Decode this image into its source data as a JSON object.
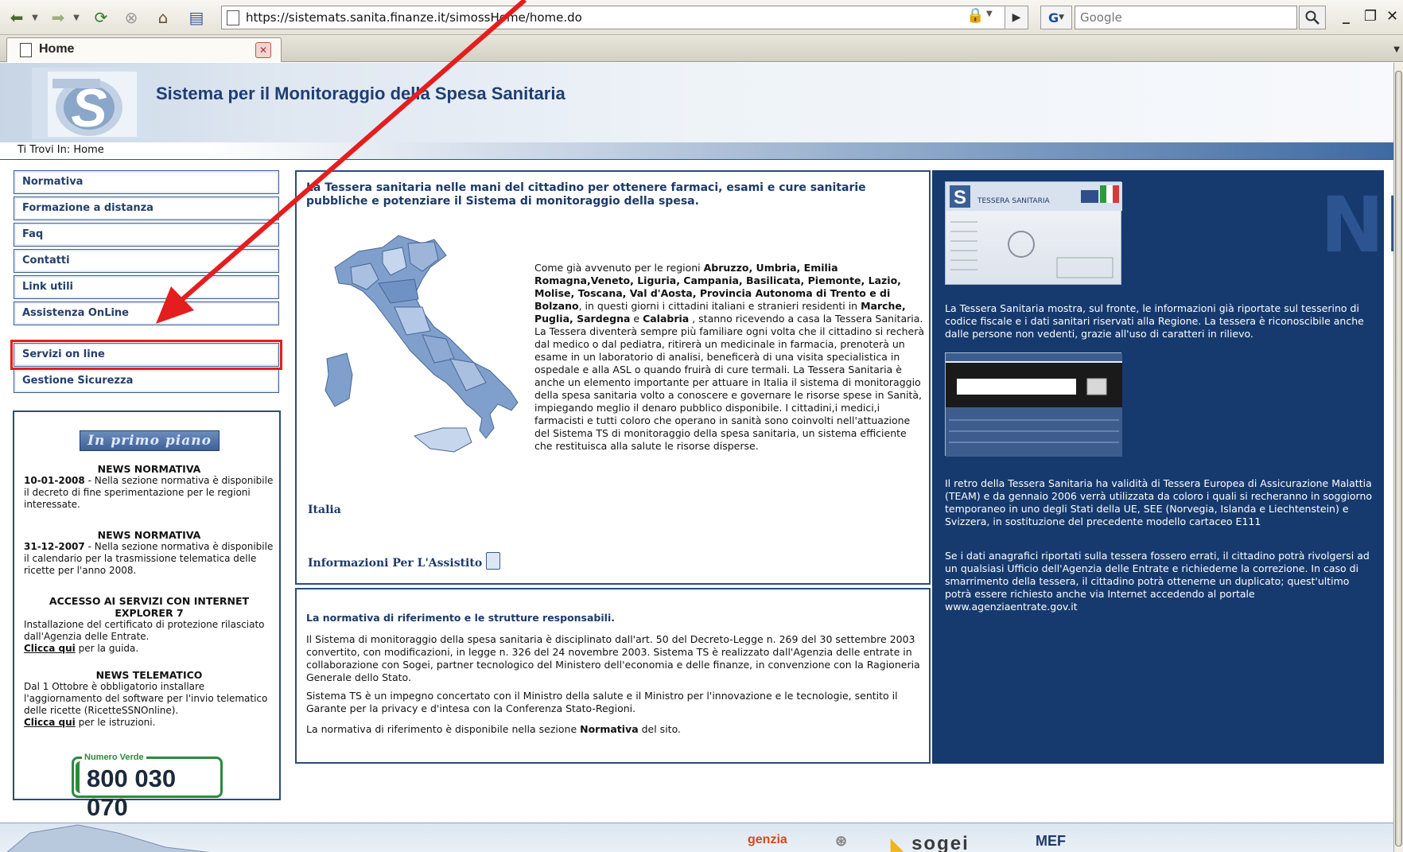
{
  "browser": {
    "url": "https://sistemats.sanita.finanze.it/simossHome/home.do",
    "search_placeholder": "Google",
    "search_engine_glyph": "G",
    "tab_label": "Home"
  },
  "site": {
    "title": "Sistema per il Monitoraggio della Spesa Sanitaria",
    "breadcrumb": "Ti Trovi In: Home"
  },
  "menu": {
    "items": [
      {
        "label": "Normativa"
      },
      {
        "label": "Formazione a distanza"
      },
      {
        "label": "Faq"
      },
      {
        "label": "Contatti"
      },
      {
        "label": "Link utili"
      },
      {
        "label": "Assistenza OnLine"
      },
      {
        "label": "Servizi on line"
      },
      {
        "label": "Gestione Sicurezza"
      }
    ]
  },
  "primo_piano": {
    "banner": "In primo piano",
    "news": [
      {
        "heading": "NEWS NORMATIVA",
        "date": "10-01-2008",
        "text": " - Nella sezione normativa è disponibile il decreto di fine sperimentazione per le regioni interessate."
      },
      {
        "heading": "NEWS NORMATIVA",
        "date": "31-12-2007",
        "text": " - Nella sezione normativa è disponibile il calendario per la trasmissione telematica delle ricette per l'anno 2008."
      },
      {
        "heading": "ACCESSO AI SERVIZI CON INTERNET EXPLORER 7",
        "text": "Installazione del certificato di protezione rilasciato dall'Agenzia delle Entrate.",
        "link": "Clicca qui",
        "link_tail": " per la guida."
      },
      {
        "heading": "NEWS TELEMATICO",
        "text": "Dal 1 Ottobre è obbligatorio installare l'aggiornamento del software per l'invio telematico delle ricette (RicetteSSNOnline).",
        "link": "Clicca qui",
        "link_tail": " per le istruzioni."
      }
    ],
    "numero_verde_label": "Numero Verde",
    "numero_verde": "800 030 070"
  },
  "center": {
    "title": "La Tessera sanitaria nelle mani del cittadino per ottenere farmaci, esami e cure sanitarie pubbliche e potenziare il Sistema di monitoraggio della spesa.",
    "body_intro": "Come già avvenuto per le regioni ",
    "body_regions1": "Abruzzo, Umbria, Emilia Romagna,Veneto, Liguria, Campania, Basilicata, Piemonte, Lazio, Molise, Toscana, Val d'Aosta, Provincia Autonoma di Trento e di Bolzano",
    "body_mid": ", in questi giorni i cittadini italiani e stranieri residenti in ",
    "body_regions2": "Marche, Puglia, Sardegna",
    "body_e": " e ",
    "body_regions3": "Calabria",
    "body_rest": " , stanno ricevendo a casa la Tessera Sanitaria. La Tessera diventerà sempre più familiare ogni volta che il cittadino si recherà dal medico o dal pediatra, ritirerà un medicinale in farmacia, prenoterà un esame in un laboratorio di analisi, beneficerà di una visita specialistica in ospedale e alla ASL o quando fruirà di cure termali. La Tessera Sanitaria è anche un elemento importante per attuare in Italia il sistema di monitoraggio della spesa sanitaria volto a conoscere e governare le risorse spese in Sanità, impiegando meglio il denaro pubblico disponibile. I cittadini,i medici,i farmacisti e tutti coloro che operano in sanità sono coinvolti nell'attuazione del Sistema TS di monitoraggio della spesa sanitaria, un sistema efficiente che restituisca alla salute le risorse disperse.",
    "map_label": "Italia",
    "info_link": "Informazioni Per L'Assistito"
  },
  "normativa": {
    "title": "La normativa di riferimento e le strutture responsabili.",
    "p1": "Il Sistema di monitoraggio della spesa sanitaria è disciplinato dall'art. 50 del Decreto-Legge n. 269 del 30 settembre 2003 convertito, con modificazioni, in legge n. 326 del 24 novembre 2003. Sistema TS è realizzato dall'Agenzia delle entrate in collaborazione con Sogei, partner tecnologico del Ministero dell'economia e delle finanze, in convenzione con la Ragioneria Generale dello Stato.",
    "p2": "Sistema TS è un impegno concertato con il Ministro della salute e il Ministro per l'innovazione e le tecnologie, sentito il Garante per la privacy e d'intesa con la Conferenza Stato-Regioni.",
    "p3_a": "La normativa di riferimento è disponibile nella sezione ",
    "p3_b": "Normativa",
    "p3_c": " del sito."
  },
  "news_panel": {
    "watermark": "NEWS",
    "card_front_title": "TESSERA SANITARIA",
    "p1": "La Tessera Sanitaria mostra, sul fronte, le informazioni già riportate sul tesserino di codice fiscale e i dati sanitari riservati alla Regione. La tessera è riconoscibile anche dalle persone non vedenti, grazie all'uso di caratteri in rilievo.",
    "p2": "Il retro della Tessera Sanitaria ha validità di Tessera Europea di Assicurazione Malattia (TEAM) e da gennaio 2006 verrà utilizzata da coloro i quali si recheranno in soggiorno temporaneo in uno degli Stati della UE, SEE (Norvegia, Islanda e Liechtenstein) e Svizzera, in sostituzione del precedente modello cartaceo E111",
    "p3": "Se i dati anagrafici riportati sulla tessera fossero errati, il cittadino potrà rivolgersi ad un qualsiasi Ufficio dell'Agenzia delle Entrate e richiederne la correzione. In caso di smarrimento della tessera, il cittadino potrà ottenerne un duplicato; quest'ultimo potrà essere richiesto anche via Internet accedendo al portale www.agenziaentrate.gov.it"
  },
  "footer": {
    "logos": [
      "genzia",
      "sogei",
      "MEF"
    ]
  },
  "colors": {
    "accent_navy": "#163a6e",
    "title_blue": "#1e3e74",
    "highlight_red": "#e41e1e",
    "verde_green": "#2b8a3e"
  }
}
